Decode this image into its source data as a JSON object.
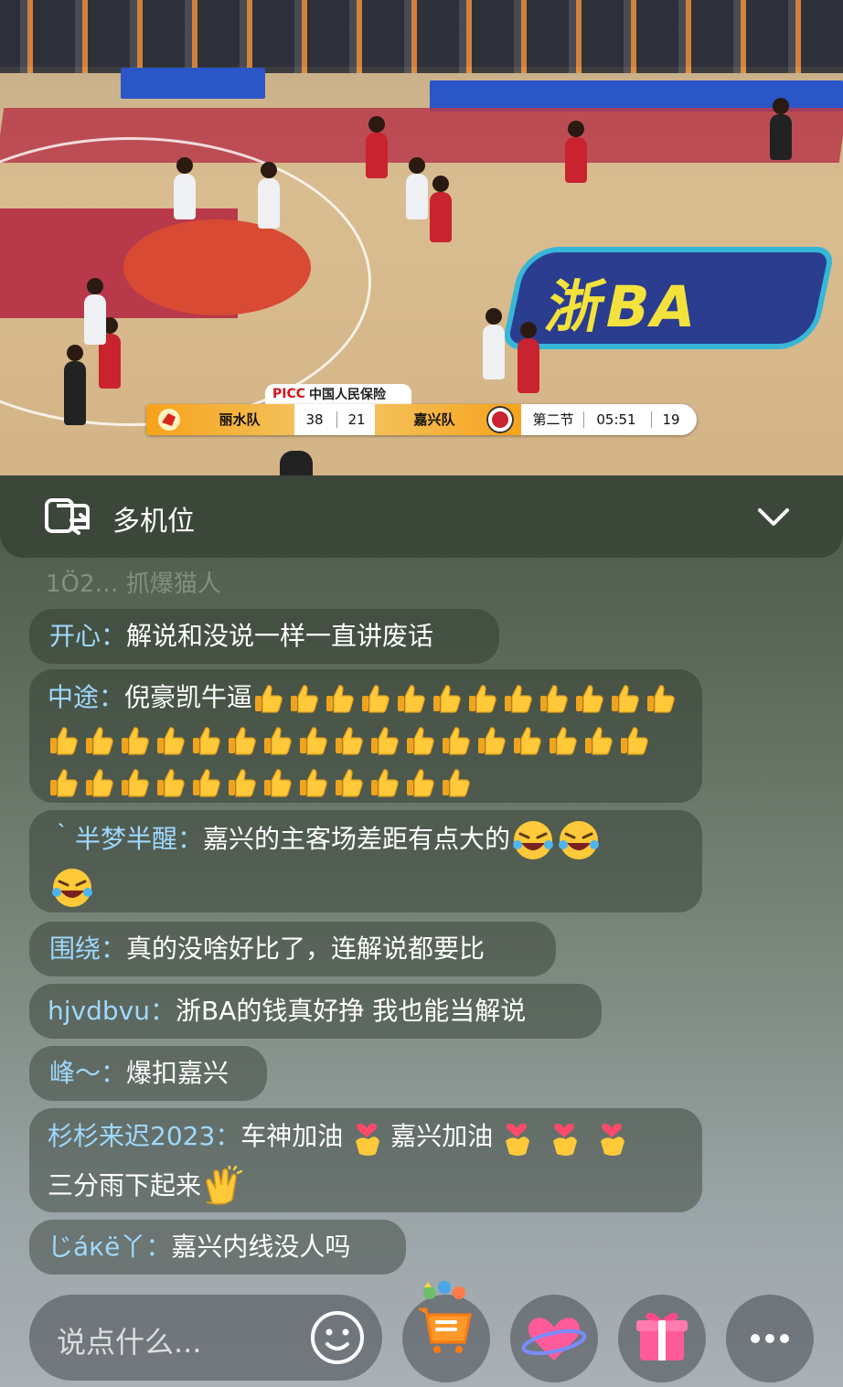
{
  "scoreboard": {
    "sponsor_brand": "PICC",
    "sponsor_name": "中国人民保险",
    "home_team": "丽水队",
    "home_score": "38",
    "away_score": "21",
    "away_team": "嘉兴队",
    "period": "第二节",
    "clock": "05:51",
    "shot_clock": "19"
  },
  "video": {
    "court_logo": "浙BA",
    "colors": {
      "court_red": "#b8394a",
      "banner_blue": "#2b56c8",
      "logo_yellow": "#f4e23c"
    }
  },
  "multicam": {
    "label": "多机位",
    "icon": "multicam-switch-icon",
    "toggle_icon": "chevron-down-icon"
  },
  "chat": {
    "faded_text": "1Ö2… 抓爆猫人",
    "messages": [
      {
        "user": "开心",
        "sep": "：",
        "text": "解说和没说一样一直讲废话"
      },
      {
        "user": "中途",
        "sep": "：",
        "text": "倪豪凯牛逼",
        "thumbs": 41
      },
      {
        "user": "｀半梦半醒",
        "sep": "：",
        "text": "嘉兴的主客场差距有点大的"
      },
      {
        "user": "围绕",
        "sep": "：",
        "text": "真的没啥好比了，连解说都要比"
      },
      {
        "user": "hjvdbvu",
        "sep": "：",
        "text": "浙BA的钱真好挣 我也能当解说"
      },
      {
        "user": "峰～",
        "sep": "：",
        "text": "爆扣嘉兴"
      },
      {
        "user": "杉杉来迟2023",
        "sep": "：",
        "text_a": "车神加油",
        "text_b": "嘉兴加油",
        "text_c": "三分雨下起来"
      },
      {
        "user": "じáкё丫",
        "sep": "：",
        "text": "嘉兴内线没人吗"
      }
    ],
    "accent_color": "#9fd9ff"
  },
  "bottom_bar": {
    "input_placeholder": "说点什么...",
    "buttons": [
      "emoji-icon",
      "shopping-cart-icon",
      "heart-icon",
      "gift-icon",
      "more-icon"
    ]
  }
}
